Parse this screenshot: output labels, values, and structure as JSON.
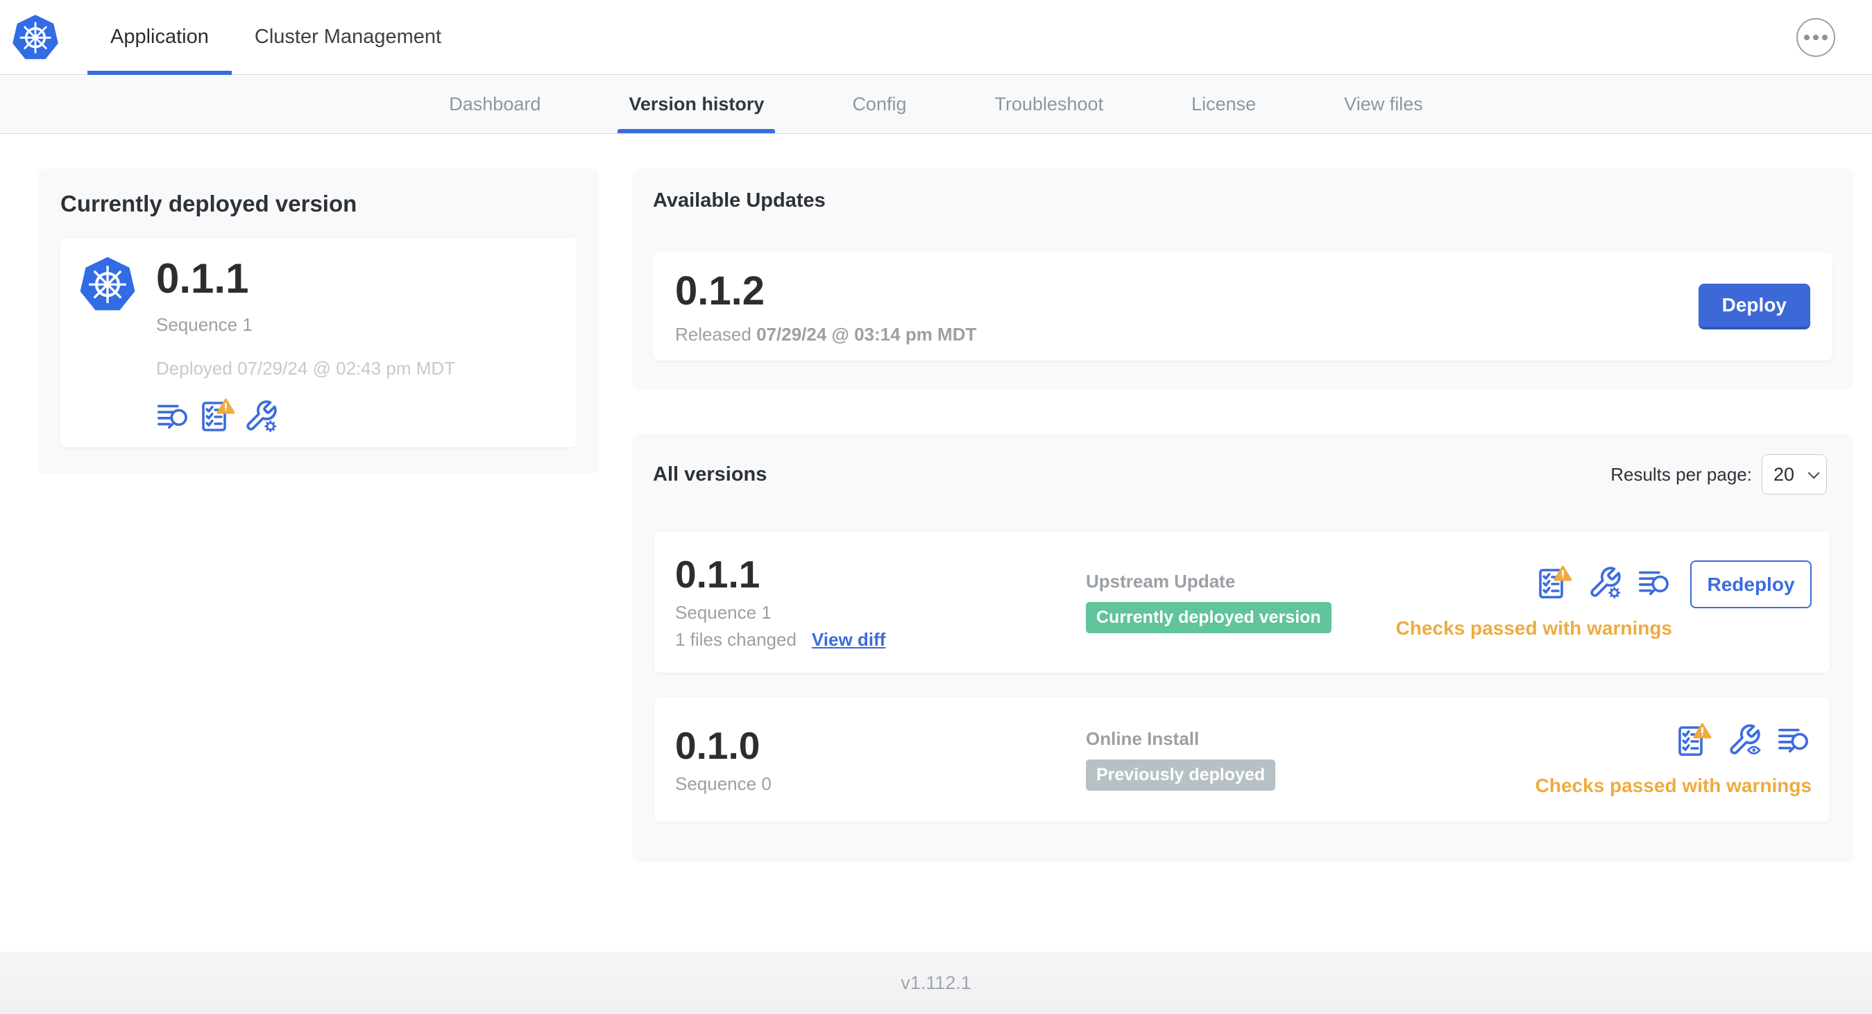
{
  "topbar": {
    "tabs": [
      {
        "label": "Application",
        "active": true
      },
      {
        "label": "Cluster Management",
        "active": false
      }
    ],
    "more_menu_icon": "ellipsis-icon"
  },
  "subnav": {
    "items": [
      "Dashboard",
      "Version history",
      "Config",
      "Troubleshoot",
      "License",
      "View files"
    ],
    "active": "Version history"
  },
  "current": {
    "title": "Currently deployed version",
    "version": "0.1.1",
    "sequence": "Sequence 1",
    "deployed": "Deployed 07/29/24 @ 02:43 pm MDT",
    "icons": [
      "view-logs-icon",
      "preflight-checks-warning-icon",
      "edit-config-icon"
    ]
  },
  "updates": {
    "title": "Available Updates",
    "version": "0.1.2",
    "released_label": "Released",
    "released_value": "07/29/24 @ 03:14 pm MDT",
    "deploy_label": "Deploy"
  },
  "versions": {
    "title": "All versions",
    "results_label": "Results per page:",
    "results_value": "20",
    "rows": [
      {
        "version": "0.1.1",
        "sequence": "Sequence 1",
        "files_changed": "1 files changed",
        "view_diff": "View diff",
        "source": "Upstream Update",
        "badge": "Currently deployed version",
        "badge_color": "green",
        "icons": [
          "preflight-checks-warning-icon",
          "edit-config-icon",
          "view-logs-icon"
        ],
        "action_label": "Redeploy",
        "status": "Checks passed with warnings"
      },
      {
        "version": "0.1.0",
        "sequence": "Sequence 0",
        "source": "Online Install",
        "badge": "Previously deployed",
        "badge_color": "gray",
        "icons": [
          "preflight-checks-warning-icon",
          "view-config-icon",
          "view-logs-icon"
        ],
        "status": "Checks passed with warnings"
      }
    ]
  },
  "footer": {
    "app_version": "v1.112.1"
  },
  "colors": {
    "accent_blue": "#3b6cde",
    "k8s_blue": "#326ce5",
    "green_badge": "#61c49b",
    "gray_badge": "#b6c0c5",
    "warning_orange": "#eeab40",
    "card_bg": "#f8f9fb"
  }
}
